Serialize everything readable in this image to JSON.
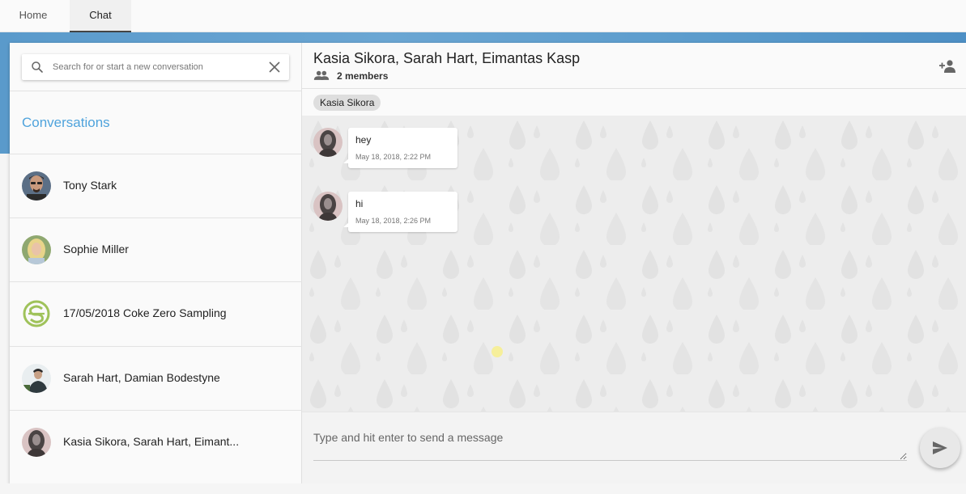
{
  "tabs": [
    {
      "label": "Home"
    },
    {
      "label": "Chat"
    }
  ],
  "search": {
    "placeholder": "Search for or start a new conversation",
    "value": ""
  },
  "sidebar": {
    "heading": "Conversations",
    "conversations": [
      {
        "name": "Tony Stark"
      },
      {
        "name": "Sophie Miller"
      },
      {
        "name": "17/05/2018 Coke Zero Sampling"
      },
      {
        "name": "Sarah Hart, Damian Bodestyne"
      },
      {
        "name": "Kasia Sikora, Sarah Hart, Eimant..."
      }
    ]
  },
  "chat": {
    "title": "Kasia Sikora, Sarah Hart, Eimantas Kasp",
    "members": "2 members",
    "chip": "Kasia Sikora",
    "messages": [
      {
        "text": "hey",
        "time": "May 18, 2018, 2:22 PM"
      },
      {
        "text": "hi",
        "time": "May 18, 2018, 2:26 PM"
      }
    ],
    "composer_placeholder": "Type and hit enter to send a message"
  },
  "colors": {
    "accent": "#4fa3dc",
    "band": "#5a9acb",
    "logo_green": "#9fc25a"
  },
  "icons": {
    "search": "search-icon",
    "clear": "close-icon",
    "members": "group-icon",
    "add_member": "person-add-icon",
    "send": "send-icon"
  }
}
